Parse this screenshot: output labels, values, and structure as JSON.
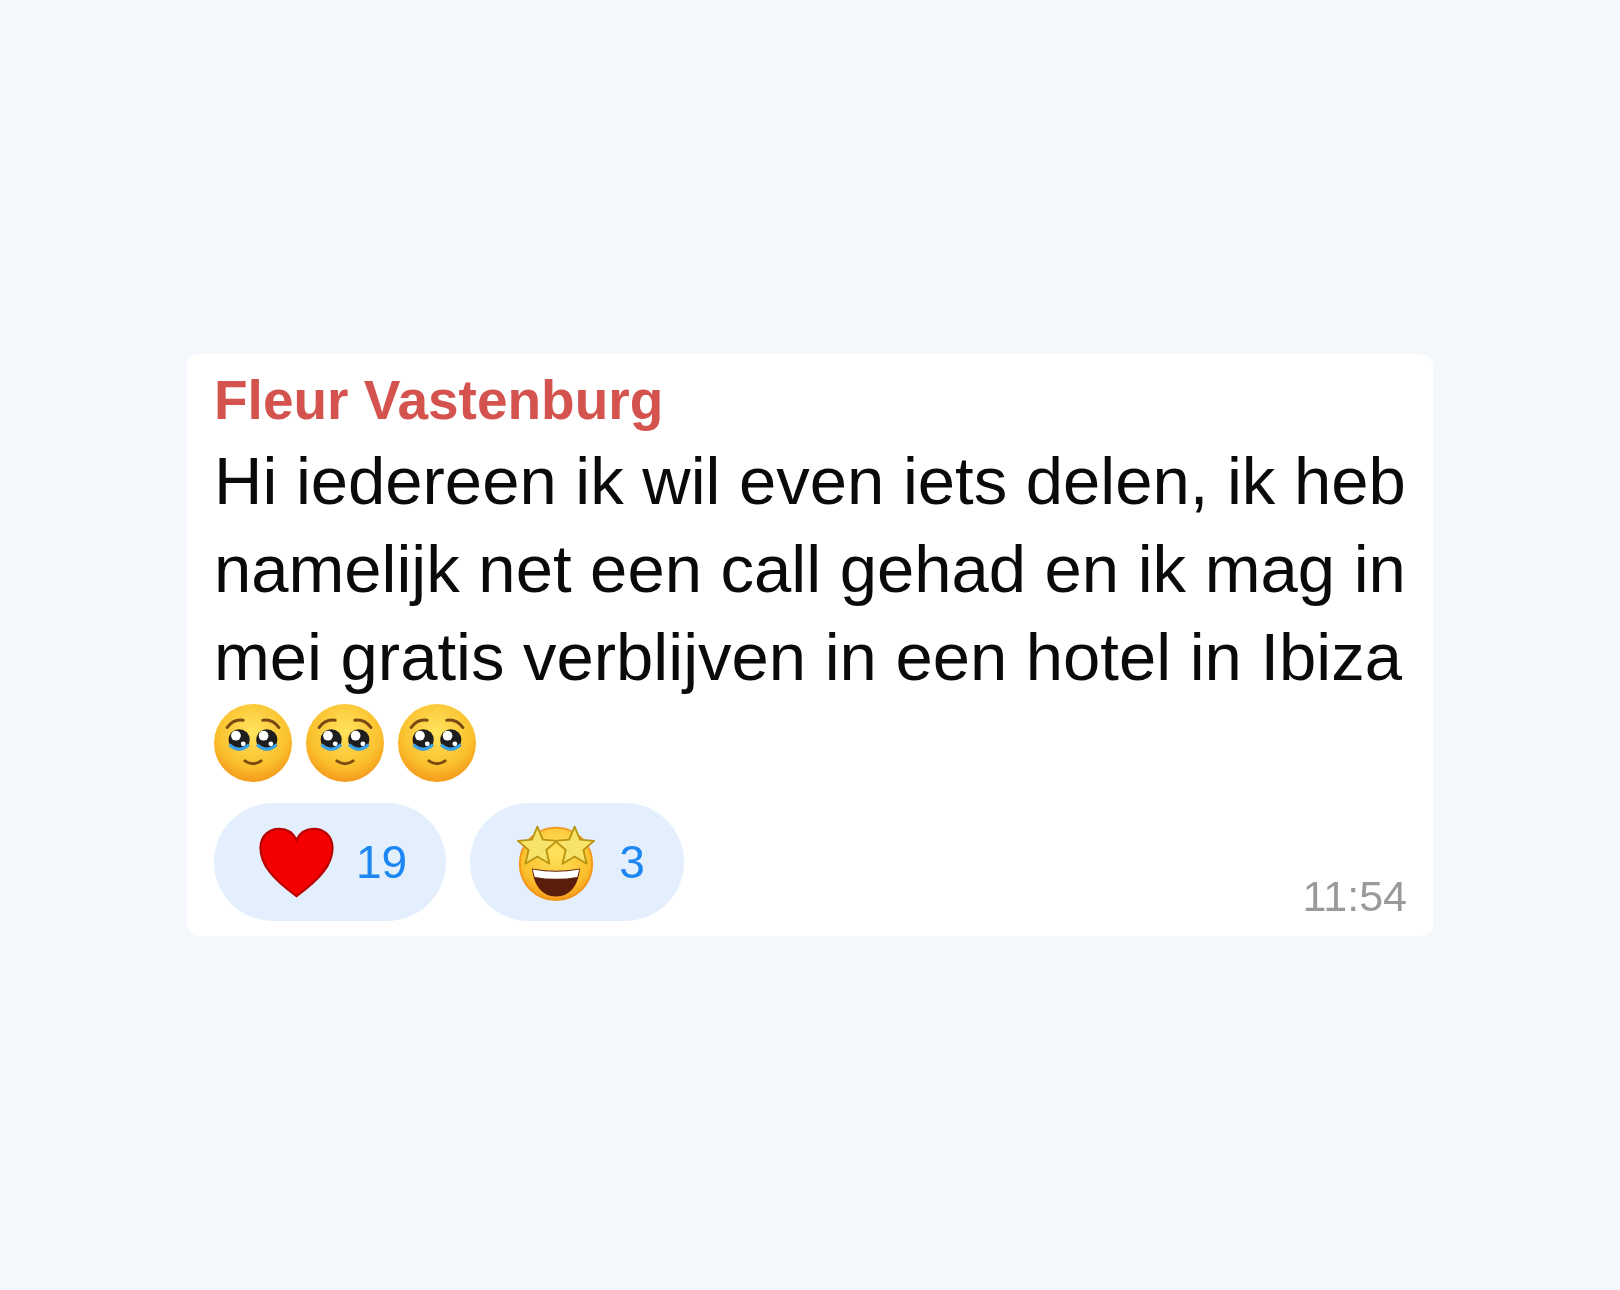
{
  "message": {
    "sender": "Fleur Vastenburg",
    "text": "Hi iedereen ik wil even iets delen, ik heb namelijk net een call gehad en ik mag in mei gratis verblijven in een hotel in Ibiza",
    "emojis": [
      {
        "kind": "pleading-face"
      },
      {
        "kind": "pleading-face"
      },
      {
        "kind": "pleading-face"
      }
    ],
    "reactions": [
      {
        "kind": "heart",
        "count": "19",
        "selected": false
      },
      {
        "kind": "star-struck",
        "count": "3",
        "selected": false
      }
    ],
    "time": "11:54"
  }
}
